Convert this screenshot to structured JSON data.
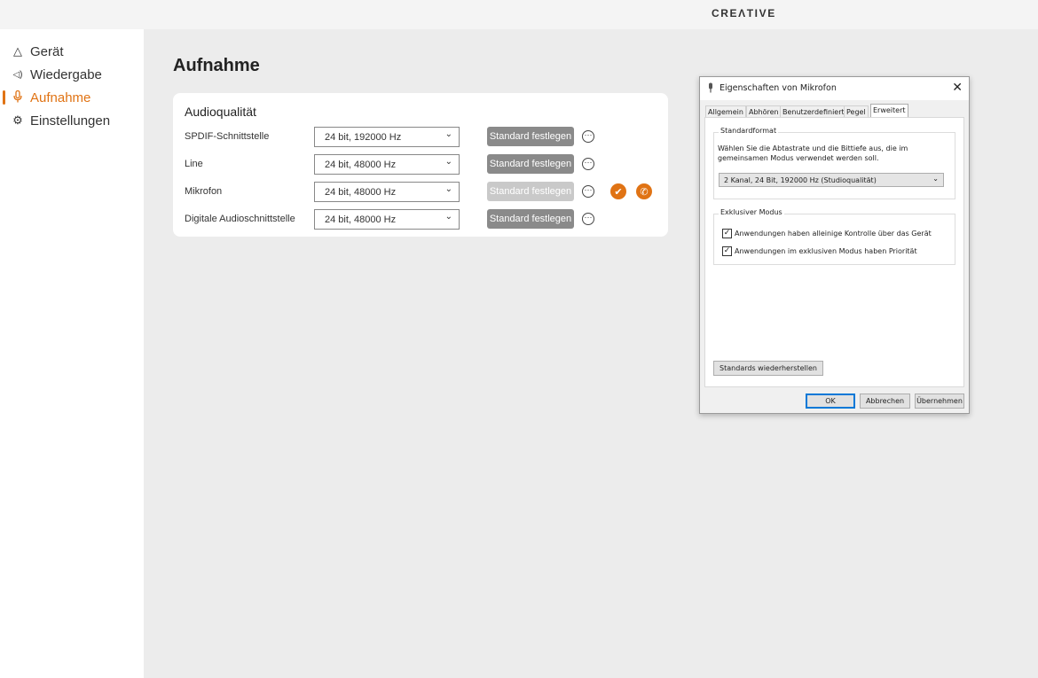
{
  "brand": "CREΛTIVE",
  "sidebar": {
    "items": [
      {
        "icon": "device-icon",
        "glyph": "△",
        "label": "Gerät"
      },
      {
        "icon": "speaker-icon",
        "glyph": "◁)",
        "label": "Wiedergabe"
      },
      {
        "icon": "microphone-icon",
        "glyph": "🎙",
        "label": "Aufnahme"
      },
      {
        "icon": "gear-icon",
        "glyph": "⚙",
        "label": "Einstellungen"
      }
    ]
  },
  "main": {
    "title": "Aufnahme",
    "card_title": "Audioqualität",
    "rows": [
      {
        "label": "SPDIF-Schnittstelle",
        "value": "24 bit, 192000 Hz",
        "button": "Standard festlegen"
      },
      {
        "label": "Line",
        "value": "24 bit, 48000 Hz",
        "button": "Standard festlegen"
      },
      {
        "label": "Mikrofon",
        "value": "24 bit, 48000 Hz",
        "button": "Standard festlegen"
      },
      {
        "label": "Digitale Audioschnittstelle",
        "value": "24 bit, 48000 Hz",
        "button": "Standard festlegen"
      }
    ]
  },
  "dialog": {
    "title": "Eigenschaften von Mikrofon",
    "tabs": [
      "Allgemein",
      "Abhören",
      "Benutzerdefiniert",
      "Pegel",
      "Erweitert"
    ],
    "active_tab": "Erweitert",
    "standard_format": {
      "heading": "Standardformat",
      "description": "Wählen Sie die Abtastrate und die Bittiefe aus, die im gemeinsamen Modus verwendet werden soll.",
      "selected": "2 Kanal, 24 Bit, 192000 Hz (Studioqualität)"
    },
    "exclusive_mode": {
      "heading": "Exklusiver Modus",
      "options": [
        {
          "label": "Anwendungen haben alleinige Kontrolle über das Gerät",
          "checked": true
        },
        {
          "label": "Anwendungen im exklusiven Modus haben Priorität",
          "checked": true
        }
      ]
    },
    "restore_button": "Standards wiederherstellen",
    "ok": "OK",
    "cancel": "Abbrechen",
    "apply": "Übernehmen"
  },
  "colors": {
    "accent": "#e07314",
    "button_gray": "#8a8a8a",
    "button_disabled": "#c9c9c9"
  }
}
